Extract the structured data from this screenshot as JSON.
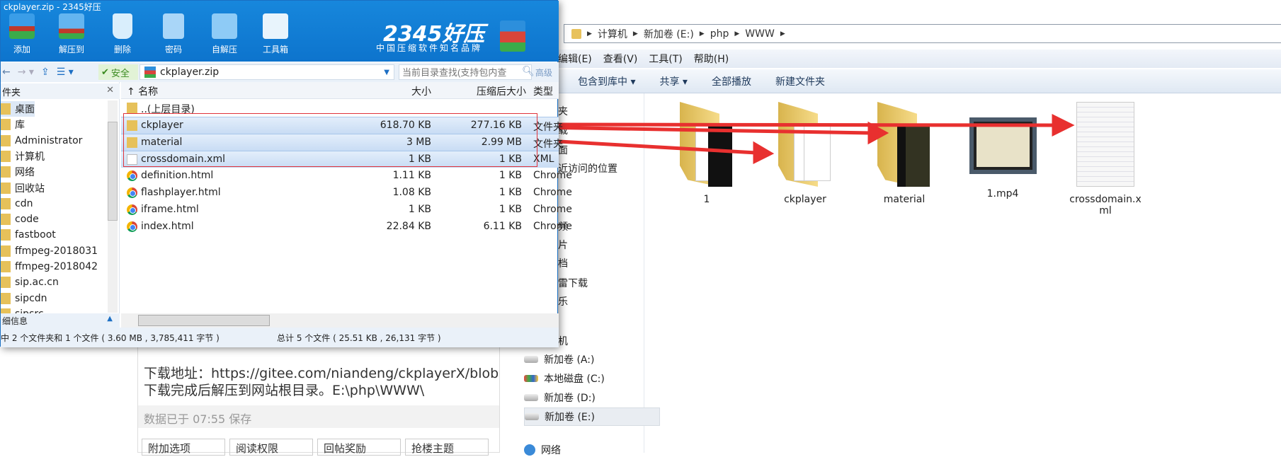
{
  "zip": {
    "title": "ckplayer.zip - 2345好压",
    "toolbar": [
      "添加",
      "解压到",
      "删除",
      "密码",
      "自解压",
      "工具箱"
    ],
    "brand": "2345好压",
    "slogan": "中国压缩软件知名品牌",
    "safe": "安全",
    "path": "ckplayer.zip",
    "search_placeholder": "当前目录查找(支持包内查",
    "advanced": "高级",
    "tree_header": "件夹",
    "tree": [
      "桌面",
      "库",
      "Administrator",
      "计算机",
      "网络",
      "回收站",
      "cdn",
      "code",
      "fastboot",
      "ffmpeg-2018031",
      "ffmpeg-2018042",
      "sip.ac.cn",
      "sipcdn",
      "sipsrc"
    ],
    "details_label": "细信息",
    "columns": [
      "名称",
      "大小",
      "压缩后大小",
      "类型"
    ],
    "rows": [
      {
        "name": "..(上层目录)",
        "size": "",
        "packed": "",
        "type": "",
        "icon": "folder-icon"
      },
      {
        "name": "ckplayer",
        "size": "618.70 KB",
        "packed": "277.16 KB",
        "type": "文件夹",
        "icon": "folder-icon"
      },
      {
        "name": "material",
        "size": "3 MB",
        "packed": "2.99 MB",
        "type": "文件夹",
        "icon": "folder-icon"
      },
      {
        "name": "crossdomain.xml",
        "size": "1 KB",
        "packed": "1 KB",
        "type": "XML",
        "icon": "file-icon"
      },
      {
        "name": "definition.html",
        "size": "1.11 KB",
        "packed": "1 KB",
        "type": "Chrome",
        "icon": "chrome-icon"
      },
      {
        "name": "flashplayer.html",
        "size": "1.08 KB",
        "packed": "1 KB",
        "type": "Chrome",
        "icon": "chrome-icon"
      },
      {
        "name": "iframe.html",
        "size": "1 KB",
        "packed": "1 KB",
        "type": "Chrome",
        "icon": "chrome-icon"
      },
      {
        "name": "index.html",
        "size": "22.84 KB",
        "packed": "6.11 KB",
        "type": "Chrome",
        "icon": "chrome-icon"
      }
    ],
    "status_left": "中 2 个文件夹和 1 个文件 ( 3.60 MB , 3,785,411 字节 )",
    "status_right": "总计 5 个文件 ( 25.51 KB , 26,131 字节 )"
  },
  "explorer": {
    "breadcrumb": [
      "计算机",
      "新加卷 (E:)",
      "php",
      "WWW"
    ],
    "menu": [
      "编辑(E)",
      "查看(V)",
      "工具(T)",
      "帮助(H)"
    ],
    "commands": [
      "包含到库中 ▾",
      "共享 ▾",
      "全部播放",
      "新建文件夹"
    ],
    "nav_partial": [
      "夹",
      "载",
      "面",
      "近访问的位置",
      "频",
      "片",
      "档",
      "雷下载",
      "乐",
      "机"
    ],
    "drives": [
      "新加卷 (A:)",
      "本地磁盘 (C:)",
      "新加卷 (D:)",
      "新加卷 (E:)"
    ],
    "network": "网络",
    "items": [
      "1",
      "ckplayer",
      "material",
      "1.mp4",
      "crossdomain.xml"
    ]
  },
  "editor": {
    "line1": "下载地址：https://gitee.com/niandeng/ckplayerX/blob",
    "line2": "下载完成后解压到网站根目录。E:\\php\\WWW\\",
    "saved": "数据已于 07:55 保存",
    "buttons": [
      "附加选项",
      "阅读权限",
      "回帖奖励",
      "抢楼主题"
    ]
  },
  "colors": {
    "zip_blue": "#0d74cd",
    "annotation_red": "#e8302f"
  }
}
